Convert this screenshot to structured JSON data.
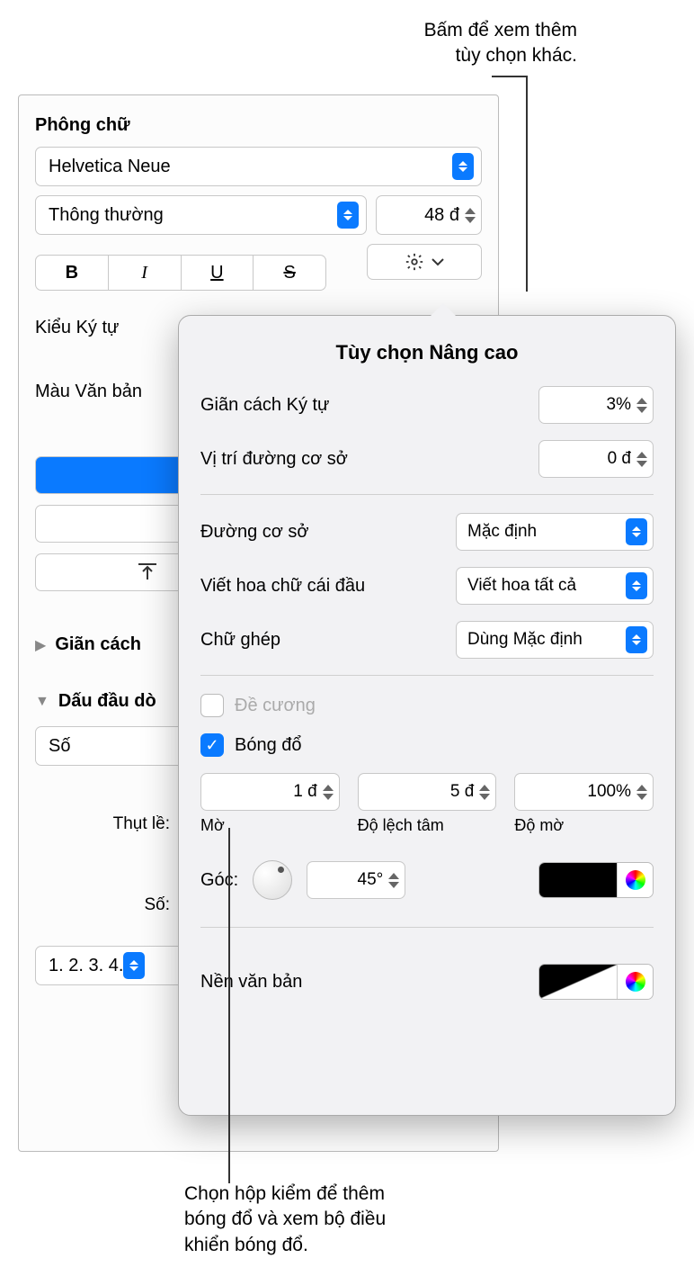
{
  "callout_top": "Bấm để xem thêm\ntùy chọn khác.",
  "callout_bottom": "Chọn hộp kiểm để thêm\nbóng đổ và xem bộ điều\nkhiển bóng đổ.",
  "panel": {
    "font_section": "Phông chữ",
    "font_family": "Helvetica Neue",
    "font_style": "Thông thường",
    "font_size": "48 đ",
    "char_style": "Kiểu Ký tự",
    "text_color": "Màu Văn bản",
    "spacing": "Giãn cách",
    "bullets": "Dấu đầu dò",
    "bullets_value": "Số",
    "indent_label": "Thụt lề:",
    "number_label": "Số:",
    "number_format": "1. 2. 3. 4."
  },
  "popover": {
    "title": "Tùy chọn Nâng cao",
    "char_spacing_label": "Giãn cách Ký tự",
    "char_spacing_value": "3%",
    "baseline_pos_label": "Vị trí đường cơ sở",
    "baseline_pos_value": "0 đ",
    "baseline_label": "Đường cơ sở",
    "baseline_value": "Mặc định",
    "caps_label": "Viết hoa chữ cái đầu",
    "caps_value": "Viết hoa tất cả",
    "ligatures_label": "Chữ ghép",
    "ligatures_value": "Dùng Mặc định",
    "outline_label": "Đề cương",
    "shadow_label": "Bóng đổ",
    "blur_value": "1 đ",
    "blur_label": "Mờ",
    "offset_value": "5 đ",
    "offset_label": "Độ lệch tâm",
    "opacity_value": "100%",
    "opacity_label": "Độ mờ",
    "angle_label": "Góc:",
    "angle_value": "45°",
    "text_bg_label": "Nền văn bản"
  }
}
